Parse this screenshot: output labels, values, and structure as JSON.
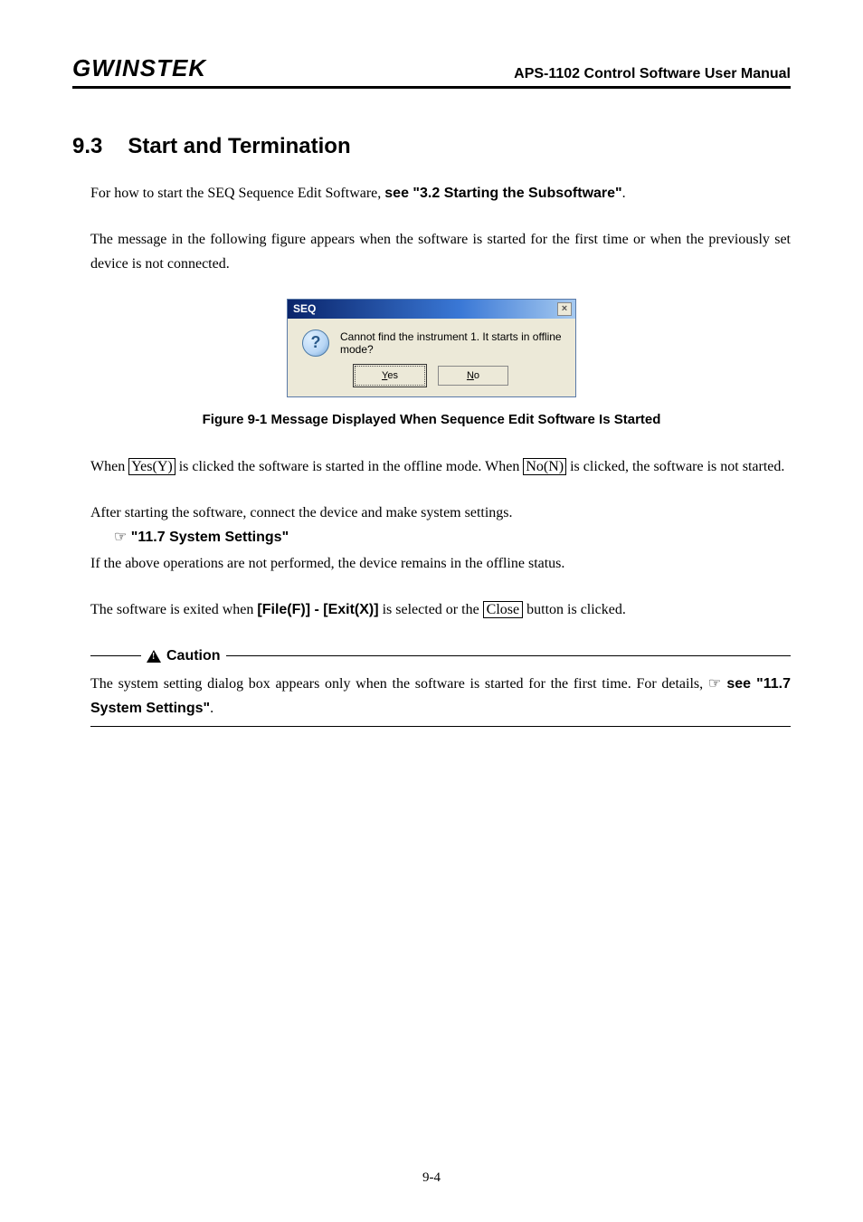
{
  "header": {
    "logo": "GWINSTEK",
    "title": "APS-1102 Control Software User Manual"
  },
  "section": {
    "number": "9.3",
    "title": "Start and Termination"
  },
  "para1_pre": "For how to start the SEQ Sequence Edit Software, ",
  "para1_bold": "see \"3.2 Starting the Subsoftware\"",
  "para1_post": ".",
  "para2": "The message in the following figure appears when the software is started for the first time or when the previously set device is not connected.",
  "dialog": {
    "title": "SEQ",
    "close": "×",
    "icon": "?",
    "message": "Cannot find the instrument 1. It starts in offline mode?",
    "yes_u": "Y",
    "yes_rest": "es",
    "no_u": "N",
    "no_rest": "o"
  },
  "figure_caption": "Figure 9-1 Message Displayed When Sequence Edit Software Is Started",
  "para3_a": "When ",
  "para3_yes": "Yes(Y)",
  "para3_b": " is clicked the software is started in the offline mode. When ",
  "para3_no": "No(N)",
  "para3_c": " is clicked, the software is not started.",
  "para4": "After starting the software, connect the device and make system settings.",
  "ref_icon": "☞",
  "ref_text": " \"11.7 System Settings\"",
  "para5": "If the above operations are not performed, the device remains in the offline status.",
  "para6_a": "The software is exited when ",
  "para6_b": "[File(F)] - [Exit(X)]",
  "para6_c": " is selected or the ",
  "para6_close": "Close",
  "para6_d": " button is clicked.",
  "caution": {
    "label": "Caution",
    "body_a": "The system setting dialog box appears only when the software is started for the first time. For details, ",
    "body_icon": "☞",
    "body_bold": " see \"11.7 System Settings\"",
    "body_post": "."
  },
  "page_number": "9-4"
}
